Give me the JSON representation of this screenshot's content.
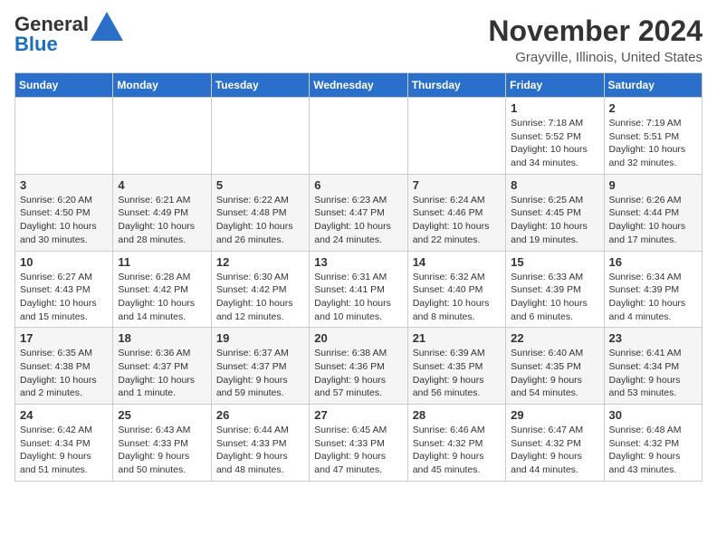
{
  "header": {
    "logo_general": "General",
    "logo_blue": "Blue",
    "month_title": "November 2024",
    "location": "Grayville, Illinois, United States"
  },
  "weekdays": [
    "Sunday",
    "Monday",
    "Tuesday",
    "Wednesday",
    "Thursday",
    "Friday",
    "Saturday"
  ],
  "weeks": [
    [
      {
        "day": "",
        "info": ""
      },
      {
        "day": "",
        "info": ""
      },
      {
        "day": "",
        "info": ""
      },
      {
        "day": "",
        "info": ""
      },
      {
        "day": "",
        "info": ""
      },
      {
        "day": "1",
        "info": "Sunrise: 7:18 AM\nSunset: 5:52 PM\nDaylight: 10 hours\nand 34 minutes."
      },
      {
        "day": "2",
        "info": "Sunrise: 7:19 AM\nSunset: 5:51 PM\nDaylight: 10 hours\nand 32 minutes."
      }
    ],
    [
      {
        "day": "3",
        "info": "Sunrise: 6:20 AM\nSunset: 4:50 PM\nDaylight: 10 hours\nand 30 minutes."
      },
      {
        "day": "4",
        "info": "Sunrise: 6:21 AM\nSunset: 4:49 PM\nDaylight: 10 hours\nand 28 minutes."
      },
      {
        "day": "5",
        "info": "Sunrise: 6:22 AM\nSunset: 4:48 PM\nDaylight: 10 hours\nand 26 minutes."
      },
      {
        "day": "6",
        "info": "Sunrise: 6:23 AM\nSunset: 4:47 PM\nDaylight: 10 hours\nand 24 minutes."
      },
      {
        "day": "7",
        "info": "Sunrise: 6:24 AM\nSunset: 4:46 PM\nDaylight: 10 hours\nand 22 minutes."
      },
      {
        "day": "8",
        "info": "Sunrise: 6:25 AM\nSunset: 4:45 PM\nDaylight: 10 hours\nand 19 minutes."
      },
      {
        "day": "9",
        "info": "Sunrise: 6:26 AM\nSunset: 4:44 PM\nDaylight: 10 hours\nand 17 minutes."
      }
    ],
    [
      {
        "day": "10",
        "info": "Sunrise: 6:27 AM\nSunset: 4:43 PM\nDaylight: 10 hours\nand 15 minutes."
      },
      {
        "day": "11",
        "info": "Sunrise: 6:28 AM\nSunset: 4:42 PM\nDaylight: 10 hours\nand 14 minutes."
      },
      {
        "day": "12",
        "info": "Sunrise: 6:30 AM\nSunset: 4:42 PM\nDaylight: 10 hours\nand 12 minutes."
      },
      {
        "day": "13",
        "info": "Sunrise: 6:31 AM\nSunset: 4:41 PM\nDaylight: 10 hours\nand 10 minutes."
      },
      {
        "day": "14",
        "info": "Sunrise: 6:32 AM\nSunset: 4:40 PM\nDaylight: 10 hours\nand 8 minutes."
      },
      {
        "day": "15",
        "info": "Sunrise: 6:33 AM\nSunset: 4:39 PM\nDaylight: 10 hours\nand 6 minutes."
      },
      {
        "day": "16",
        "info": "Sunrise: 6:34 AM\nSunset: 4:39 PM\nDaylight: 10 hours\nand 4 minutes."
      }
    ],
    [
      {
        "day": "17",
        "info": "Sunrise: 6:35 AM\nSunset: 4:38 PM\nDaylight: 10 hours\nand 2 minutes."
      },
      {
        "day": "18",
        "info": "Sunrise: 6:36 AM\nSunset: 4:37 PM\nDaylight: 10 hours\nand 1 minute."
      },
      {
        "day": "19",
        "info": "Sunrise: 6:37 AM\nSunset: 4:37 PM\nDaylight: 9 hours\nand 59 minutes."
      },
      {
        "day": "20",
        "info": "Sunrise: 6:38 AM\nSunset: 4:36 PM\nDaylight: 9 hours\nand 57 minutes."
      },
      {
        "day": "21",
        "info": "Sunrise: 6:39 AM\nSunset: 4:35 PM\nDaylight: 9 hours\nand 56 minutes."
      },
      {
        "day": "22",
        "info": "Sunrise: 6:40 AM\nSunset: 4:35 PM\nDaylight: 9 hours\nand 54 minutes."
      },
      {
        "day": "23",
        "info": "Sunrise: 6:41 AM\nSunset: 4:34 PM\nDaylight: 9 hours\nand 53 minutes."
      }
    ],
    [
      {
        "day": "24",
        "info": "Sunrise: 6:42 AM\nSunset: 4:34 PM\nDaylight: 9 hours\nand 51 minutes."
      },
      {
        "day": "25",
        "info": "Sunrise: 6:43 AM\nSunset: 4:33 PM\nDaylight: 9 hours\nand 50 minutes."
      },
      {
        "day": "26",
        "info": "Sunrise: 6:44 AM\nSunset: 4:33 PM\nDaylight: 9 hours\nand 48 minutes."
      },
      {
        "day": "27",
        "info": "Sunrise: 6:45 AM\nSunset: 4:33 PM\nDaylight: 9 hours\nand 47 minutes."
      },
      {
        "day": "28",
        "info": "Sunrise: 6:46 AM\nSunset: 4:32 PM\nDaylight: 9 hours\nand 45 minutes."
      },
      {
        "day": "29",
        "info": "Sunrise: 6:47 AM\nSunset: 4:32 PM\nDaylight: 9 hours\nand 44 minutes."
      },
      {
        "day": "30",
        "info": "Sunrise: 6:48 AM\nSunset: 4:32 PM\nDaylight: 9 hours\nand 43 minutes."
      }
    ]
  ]
}
